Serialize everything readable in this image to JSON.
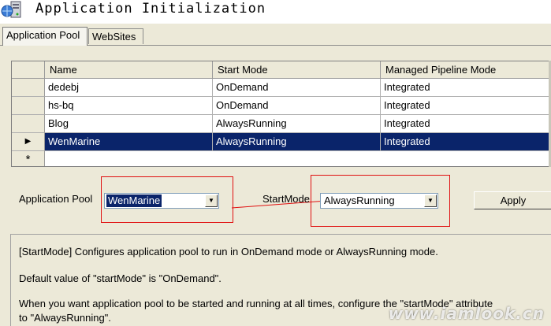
{
  "header": {
    "title": "Application Initialization",
    "icon": "server-icon"
  },
  "tabs": [
    {
      "label": "Application Pool",
      "active": true
    },
    {
      "label": "WebSites",
      "active": false
    }
  ],
  "grid": {
    "columns": [
      "Name",
      "Start Mode",
      "Managed Pipeline Mode"
    ],
    "rows": [
      {
        "name": "dedebj",
        "start_mode": "OnDemand",
        "pipeline": "Integrated",
        "selected": false
      },
      {
        "name": "hs-bq",
        "start_mode": "OnDemand",
        "pipeline": "Integrated",
        "selected": false
      },
      {
        "name": "Blog",
        "start_mode": "AlwaysRunning",
        "pipeline": "Integrated",
        "selected": false
      },
      {
        "name": "WenMarine",
        "start_mode": "AlwaysRunning",
        "pipeline": "Integrated",
        "selected": true
      }
    ],
    "selected_row_marker": "▶",
    "new_row_marker": "*"
  },
  "form": {
    "app_pool_label": "Application Pool",
    "app_pool_value": "WenMarine",
    "start_mode_label": "StartMode",
    "start_mode_value": "AlwaysRunning",
    "apply_label": "Apply"
  },
  "description": {
    "line1": "[StartMode] Configures application pool to run in OnDemand mode or AlwaysRunning mode.",
    "line2": "Default value of \"startMode\" is \"OnDemand\".",
    "line3": "When you want application pool to be started and running at all times, configure the \"startMode\" attribute",
    "line4": "to \"AlwaysRunning\"."
  },
  "watermark": "www.iamlook.cn",
  "colors": {
    "selection": "#0a246a",
    "annotation": "#e01010",
    "background": "#ece9d8"
  }
}
